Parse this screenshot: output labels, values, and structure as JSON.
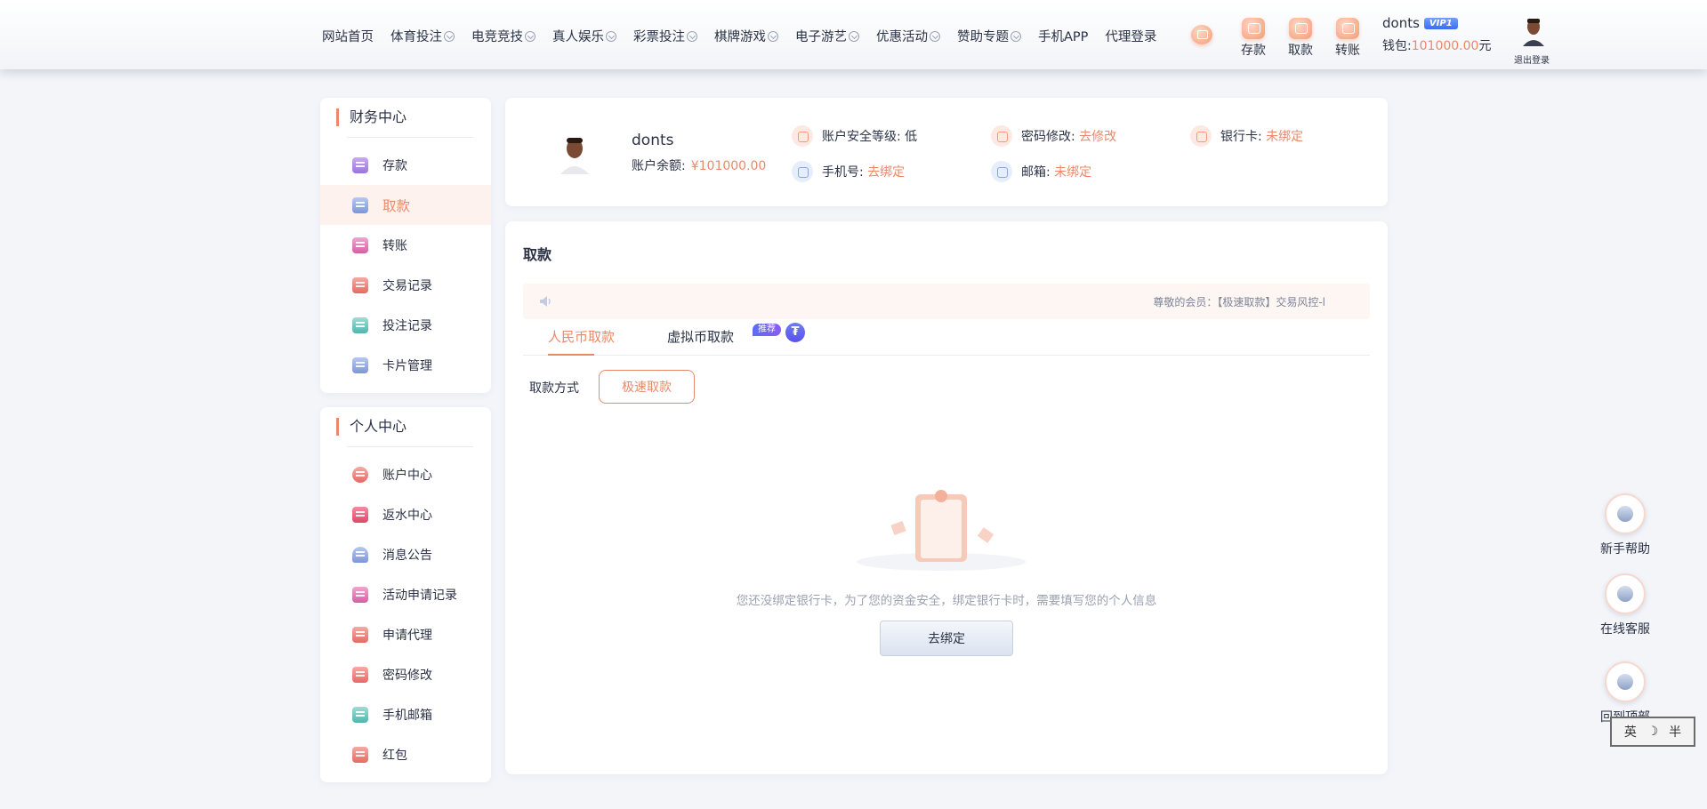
{
  "nav": [
    {
      "label": "网站首页",
      "dropdown": false
    },
    {
      "label": "体育投注",
      "dropdown": true
    },
    {
      "label": "电竞竞技",
      "dropdown": true
    },
    {
      "label": "真人娱乐",
      "dropdown": true
    },
    {
      "label": "彩票投注",
      "dropdown": true
    },
    {
      "label": "棋牌游戏",
      "dropdown": true
    },
    {
      "label": "电子游艺",
      "dropdown": true
    },
    {
      "label": "优惠活动",
      "dropdown": true
    },
    {
      "label": "赞助专题",
      "dropdown": true
    },
    {
      "label": "手机APP",
      "dropdown": false
    },
    {
      "label": "代理登录",
      "dropdown": false
    }
  ],
  "quick_actions": {
    "deposit": "存款",
    "withdraw": "取款",
    "transfer": "转账"
  },
  "user": {
    "name": "donts",
    "vip": "VIP1",
    "wallet_label": "钱包:",
    "wallet_amount": "101000.00",
    "wallet_unit": "元",
    "logout": "退出登录"
  },
  "finance": {
    "title": "财务中心",
    "items": [
      "存款",
      "取款",
      "转账",
      "交易记录",
      "投注记录",
      "卡片管理"
    ]
  },
  "personal": {
    "title": "个人中心",
    "items": [
      "账户中心",
      "返水中心",
      "消息公告",
      "活动申请记录",
      "申请代理",
      "密码修改",
      "手机邮箱",
      "红包"
    ]
  },
  "profile": {
    "name": "donts",
    "balance_label": "账户余额:",
    "balance": "¥101000.00",
    "security_label": "账户安全等级:",
    "security_value": "低",
    "password_label": "密码修改:",
    "password_link": "去修改",
    "bank_label": "银行卡:",
    "bank_link": "未绑定",
    "phone_label": "手机号:",
    "phone_link": "去绑定",
    "email_label": "邮箱:",
    "email_link": "未绑定"
  },
  "main": {
    "title": "取款",
    "notice": "尊敬的会员：【极速取款】交易风控-l",
    "tab_rmb": "人民币取款",
    "tab_crypto": "虚拟币取款",
    "badge": "推荐",
    "usdt_glyph": "₮",
    "method_label": "取款方式",
    "method_button": "极速取款",
    "empty_text": "您还没绑定银行卡，为了您的资金安全，绑定银行卡时，需要填写您的个人信息",
    "bind_button": "去绑定"
  },
  "float": {
    "help": "新手帮助",
    "service": "在线客服",
    "top": "回到顶部"
  },
  "ime": {
    "lang": "英",
    "moon": "☽",
    "width": "半"
  },
  "colors": {
    "accent": "#e9896a",
    "vip": "#3b6cf0"
  }
}
